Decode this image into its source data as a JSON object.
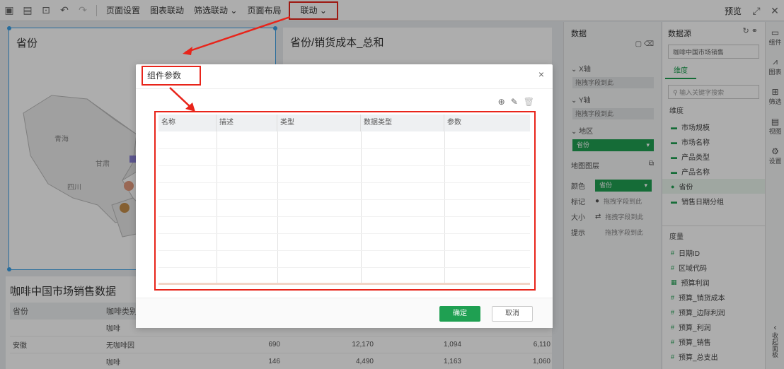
{
  "toolbar": {
    "items": [
      "页面设置",
      "图表联动",
      "筛选联动",
      "页面布局"
    ],
    "highlighted": "联动",
    "right": "预览"
  },
  "map_panel": {
    "title": "省份",
    "regions": [
      "青海",
      "甘肃",
      "四川"
    ]
  },
  "chart_panel": {
    "title": "省份/销货成本_总和"
  },
  "table_panel": {
    "title": "咖啡中国市场销售数据",
    "headers": [
      "省份",
      "咖啡类别"
    ],
    "province": "安徽",
    "rows": [
      {
        "cat": "咖啡",
        "v": [
          "",
          "",
          "",
          ""
        ]
      },
      {
        "cat": "无咖啡因",
        "v": [
          "690",
          "12,170",
          "1,094",
          "6,110"
        ]
      },
      {
        "cat": "咖啡",
        "v": [
          "146",
          "4,490",
          "1,163",
          "1,060"
        ]
      }
    ]
  },
  "config": {
    "title": "数据",
    "x_label": "X轴",
    "x_value": "拖拽字段到此",
    "y_label": "Y轴",
    "y_value": "拖拽字段到此",
    "geo_label": "地区",
    "geo_value": "省份",
    "layer_label": "地图图层",
    "color_label": "颜色",
    "color_value": "省份",
    "marker_label": "标记",
    "marker_value": "拖拽字段到此",
    "size_label": "大小",
    "size_value": "拖拽字段到此",
    "tooltip_label": "提示",
    "tooltip_value": "拖拽字段到此"
  },
  "data_panel": {
    "title": "数据源",
    "dataset": "咖啡中国市场销售",
    "tab": "维度",
    "search_placeholder": "输入关键字搜索",
    "dimensions": [
      "市场规模",
      "市场名称",
      "产品类型",
      "产品名称",
      "省份",
      "销售日期分组"
    ],
    "measures_title": "度量",
    "measures": [
      "日期ID",
      "区域代码",
      "预算利润",
      "预算_销货成本",
      "预算_边际利润",
      "预算_利润",
      "预算_销售",
      "预算_总支出"
    ]
  },
  "strip": [
    "组件",
    "图表",
    "筛选",
    "视图",
    "设置",
    "收起面板"
  ],
  "modal": {
    "title": "组件参数",
    "columns": [
      "名称",
      "描述",
      "类型",
      "数据类型",
      "参数"
    ],
    "ok": "确定",
    "cancel": "取消"
  }
}
